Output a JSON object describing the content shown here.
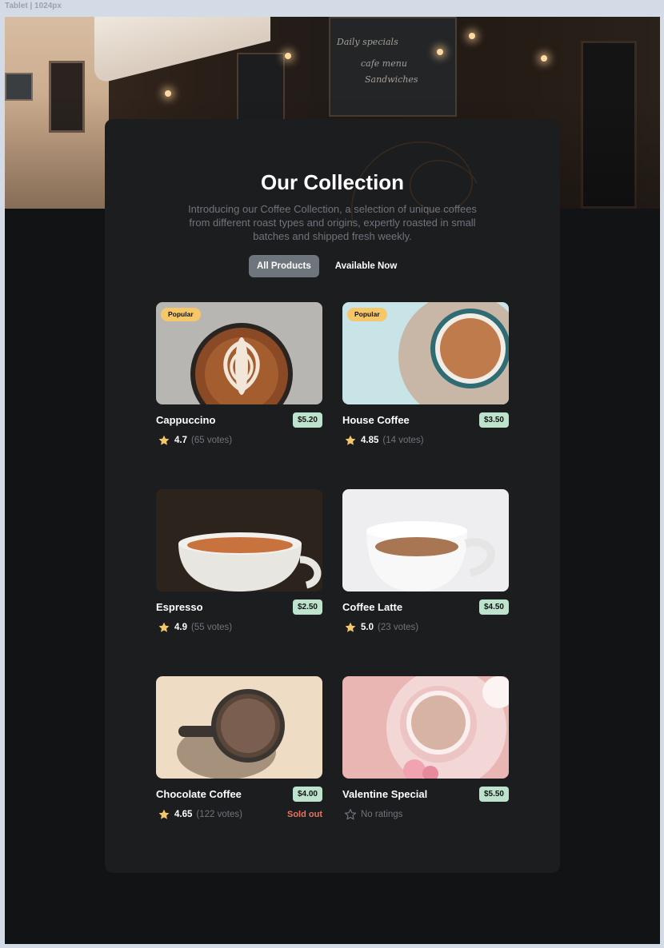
{
  "frame_label": "Tablet | 1024px",
  "header": {
    "title": "Our Collection",
    "subtitle": "Introducing our Coffee Collection, a selection of unique coffees from different roast types and origins, expertly roasted in small batches and shipped fresh weekly."
  },
  "tabs": [
    {
      "label": "All Products",
      "active": true
    },
    {
      "label": "Available Now",
      "active": false
    }
  ],
  "products": [
    {
      "name": "Cappuccino",
      "price": "$5.20",
      "rating": "4.7",
      "votes": "(65 votes)",
      "badge": "Popular",
      "sold_out": ""
    },
    {
      "name": "House Coffee",
      "price": "$3.50",
      "rating": "4.85",
      "votes": "(14 votes)",
      "badge": "Popular",
      "sold_out": ""
    },
    {
      "name": "Espresso",
      "price": "$2.50",
      "rating": "4.9",
      "votes": "(55 votes)",
      "badge": "",
      "sold_out": ""
    },
    {
      "name": "Coffee Latte",
      "price": "$4.50",
      "rating": "5.0",
      "votes": "(23 votes)",
      "badge": "",
      "sold_out": ""
    },
    {
      "name": "Chocolate Coffee",
      "price": "$4.00",
      "rating": "4.65",
      "votes": "(122 votes)",
      "badge": "",
      "sold_out": "Sold out"
    },
    {
      "name": "Valentine Special",
      "price": "$5.50",
      "rating": "",
      "votes": "",
      "no_ratings_text": "No ratings",
      "badge": "",
      "sold_out": ""
    }
  ],
  "colors": {
    "page_bg": "#111315",
    "card_bg": "#1b1d1f",
    "accent_badge": "#f6c768",
    "price_bg": "#bee3cc",
    "muted_text": "#6f757c",
    "sold_out": "#ed735d",
    "star": "#f6c768"
  },
  "icons": {
    "star_filled": "star-filled-icon",
    "star_empty": "star-empty-icon"
  }
}
